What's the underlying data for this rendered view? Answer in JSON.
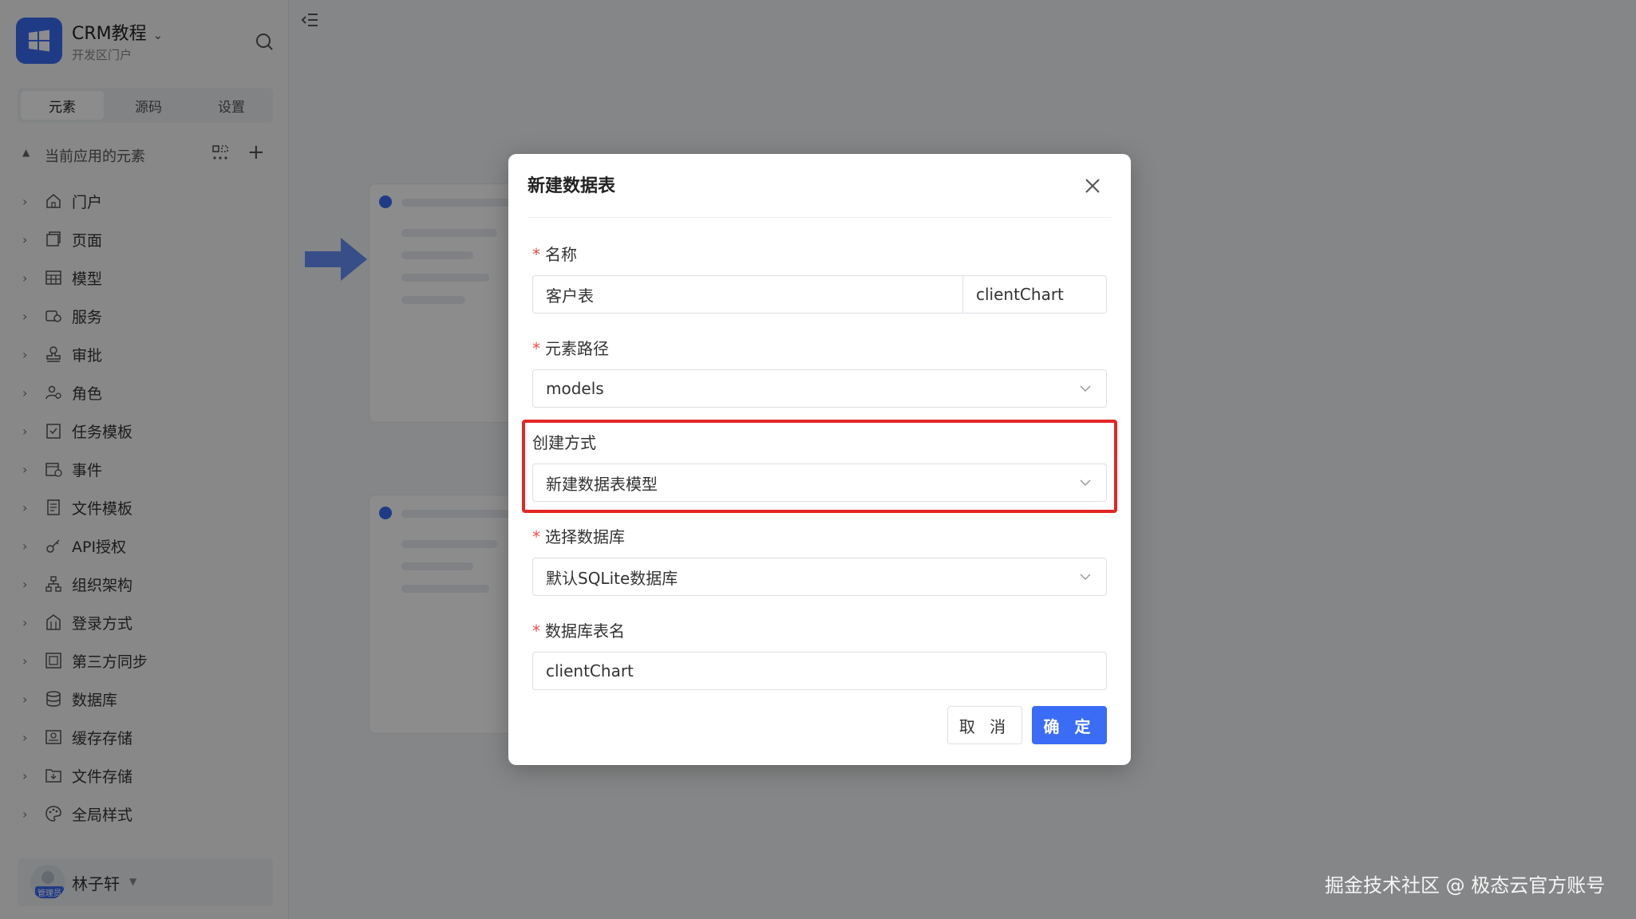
{
  "app": {
    "name": "CRM教程",
    "subtitle": "开发区门户"
  },
  "sidebar": {
    "tabs": [
      {
        "label": "元素",
        "active": true
      },
      {
        "label": "源码",
        "active": false
      },
      {
        "label": "设置",
        "active": false
      }
    ],
    "tree_header": "当前应用的元素",
    "items": [
      {
        "label": "门户",
        "icon": "home-icon"
      },
      {
        "label": "页面",
        "icon": "page-icon"
      },
      {
        "label": "模型",
        "icon": "table-icon"
      },
      {
        "label": "服务",
        "icon": "service-icon"
      },
      {
        "label": "审批",
        "icon": "stamp-icon"
      },
      {
        "label": "角色",
        "icon": "roles-icon"
      },
      {
        "label": "任务模板",
        "icon": "task-icon"
      },
      {
        "label": "事件",
        "icon": "event-icon"
      },
      {
        "label": "文件模板",
        "icon": "file-template-icon"
      },
      {
        "label": "API授权",
        "icon": "key-icon"
      },
      {
        "label": "组织架构",
        "icon": "org-icon"
      },
      {
        "label": "登录方式",
        "icon": "login-icon"
      },
      {
        "label": "第三方同步",
        "icon": "sync-icon"
      },
      {
        "label": "数据库",
        "icon": "database-icon"
      },
      {
        "label": "缓存存储",
        "icon": "cache-icon"
      },
      {
        "label": "文件存储",
        "icon": "folder-icon"
      },
      {
        "label": "全局样式",
        "icon": "palette-icon"
      }
    ],
    "user": {
      "name": "林子轩",
      "badge": "管理员"
    }
  },
  "modal": {
    "title": "新建数据表",
    "name_label": "名称",
    "name_value": "客户表",
    "code_value": "clientChart",
    "path_label": "元素路径",
    "path_value": "models",
    "mode_label": "创建方式",
    "mode_value": "新建数据表模型",
    "db_label": "选择数据库",
    "db_value": "默认SQLite数据库",
    "table_label": "数据库表名",
    "table_value": "clientChart",
    "cancel_label": "取 消",
    "ok_label": "确 定"
  },
  "watermark": "掘金技术社区 @ 极态云官方账号",
  "colors": {
    "primary": "#3b6cf5",
    "highlight": "#e32626",
    "required": "#f04a4a"
  }
}
